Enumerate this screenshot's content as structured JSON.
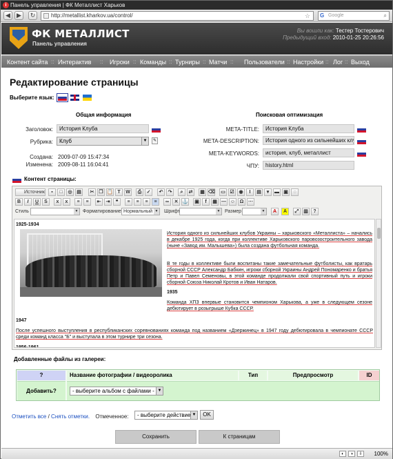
{
  "window": {
    "title": "Панель управления | ФК Металлист Харьков"
  },
  "browser": {
    "url": "http://metallist.kharkov.ua/control/",
    "search_placeholder": "Google",
    "zoom": "100%"
  },
  "header": {
    "logo_title": "ФК МЕТАЛЛИСТ",
    "logo_sub": "Панель управления",
    "login_label": "Вы вошли как:",
    "login_value": "Тестер Тостерович",
    "prev_label": "Предыдущий вход:",
    "prev_value": "2010-01-25 20:26:56"
  },
  "menu": [
    "Контент сайта",
    "Интерактив",
    "Игроки",
    "Команды",
    "Турниры",
    "Матчи",
    "Пользователи",
    "Настройки",
    "Лог",
    "Выход"
  ],
  "menu_sep": "::",
  "page": {
    "title": "Редактирование страницы",
    "lang_label": "Выберите язык:"
  },
  "general": {
    "heading": "Общая информация",
    "title_label": "Заголовок:",
    "title_value": "История Клуба",
    "rubric_label": "Рубрика:",
    "rubric_value": "Клуб",
    "created_label": "Создана:",
    "created_value": "2009-07-09 15:47:34",
    "changed_label": "Изменена:",
    "changed_value": "2009-08-11 16:04:41"
  },
  "seo": {
    "heading": "Поисковая оптимизация",
    "meta_title_label": "META-TITLE:",
    "meta_title_value": "История Клуба",
    "meta_desc_label": "META-DESCRIPTION:",
    "meta_desc_value": "История одного из сильнейших клуб",
    "meta_kw_label": "META-KEYWORDS:",
    "meta_kw_value": "история, клуб, металлист",
    "chpu_label": "ЧПУ:",
    "chpu_value": "history.html"
  },
  "content": {
    "label": "Контент страницы:"
  },
  "editor": {
    "source_label": "Источник",
    "style_label": "Стиль",
    "format_label": "Форматирование",
    "format_value": "Нормальный",
    "font_label": "Шрифт",
    "size_label": "Размер"
  },
  "article": {
    "year1": "1925-1934",
    "para1": "История одного из сильнейших клубов Украины – харьковского «Металлиста» – начались в декабре 1925 года, когда при коллективе Харьковского паровозостроительного завода (ныне «Завод им. Малышева») была создана футбольная команда.",
    "para2": "В те годы в коллективе были воспитаны такие замечательные футболисты, как вратарь сборной СССР Александр Бабкин, игроки сборной Украины Андрей Пономаренко и братья Петр и Павел Семеновы, в этой команде продолжали свой спортивный путь и игроки сборной Союза Николай Кротов и Иван Натаров.",
    "year2": "1935",
    "para3": "Команда ХПЗ впервые становится чемпионом Харькова, а уже в следующем сезоне дебютирует в розыгрыше Кубка СССР.",
    "year3": "1947",
    "para4": "После успешного выступления в республиканских соревнованиях команда под названием «Дзержинец» в 1947 году дебютировала в чемпионате СССР среди команд класса \"Б\" и выступала в этом турнире три сезона.",
    "year4": "1956-1961"
  },
  "gallery": {
    "label": "Добавленные файлы из галереи:",
    "col_q": "?",
    "col_name": "Название фотографии / видеоролика",
    "col_type": "Тип",
    "col_preview": "Предпросмотр",
    "col_id": "ID",
    "add_label": "Добавить?",
    "album_select": "- выберите альбом с файлами -"
  },
  "bulk": {
    "mark_all": "Отметить все",
    "sep": " / ",
    "unmark": "Снять отметки.",
    "marked_label": "Отмеченное:",
    "action_select": "- выберите действие -",
    "ok": "OK"
  },
  "buttons": {
    "save": "Сохранить",
    "to_pages": "К страницам"
  },
  "colors": {
    "menu_bg": "#7a7a7a",
    "header_bg": "#3a3a3a",
    "gallery_bg": "#d4f4cf",
    "q_col": "#cfd3f5",
    "id_col": "#f5d0d0",
    "link": "#1a4fc0"
  }
}
